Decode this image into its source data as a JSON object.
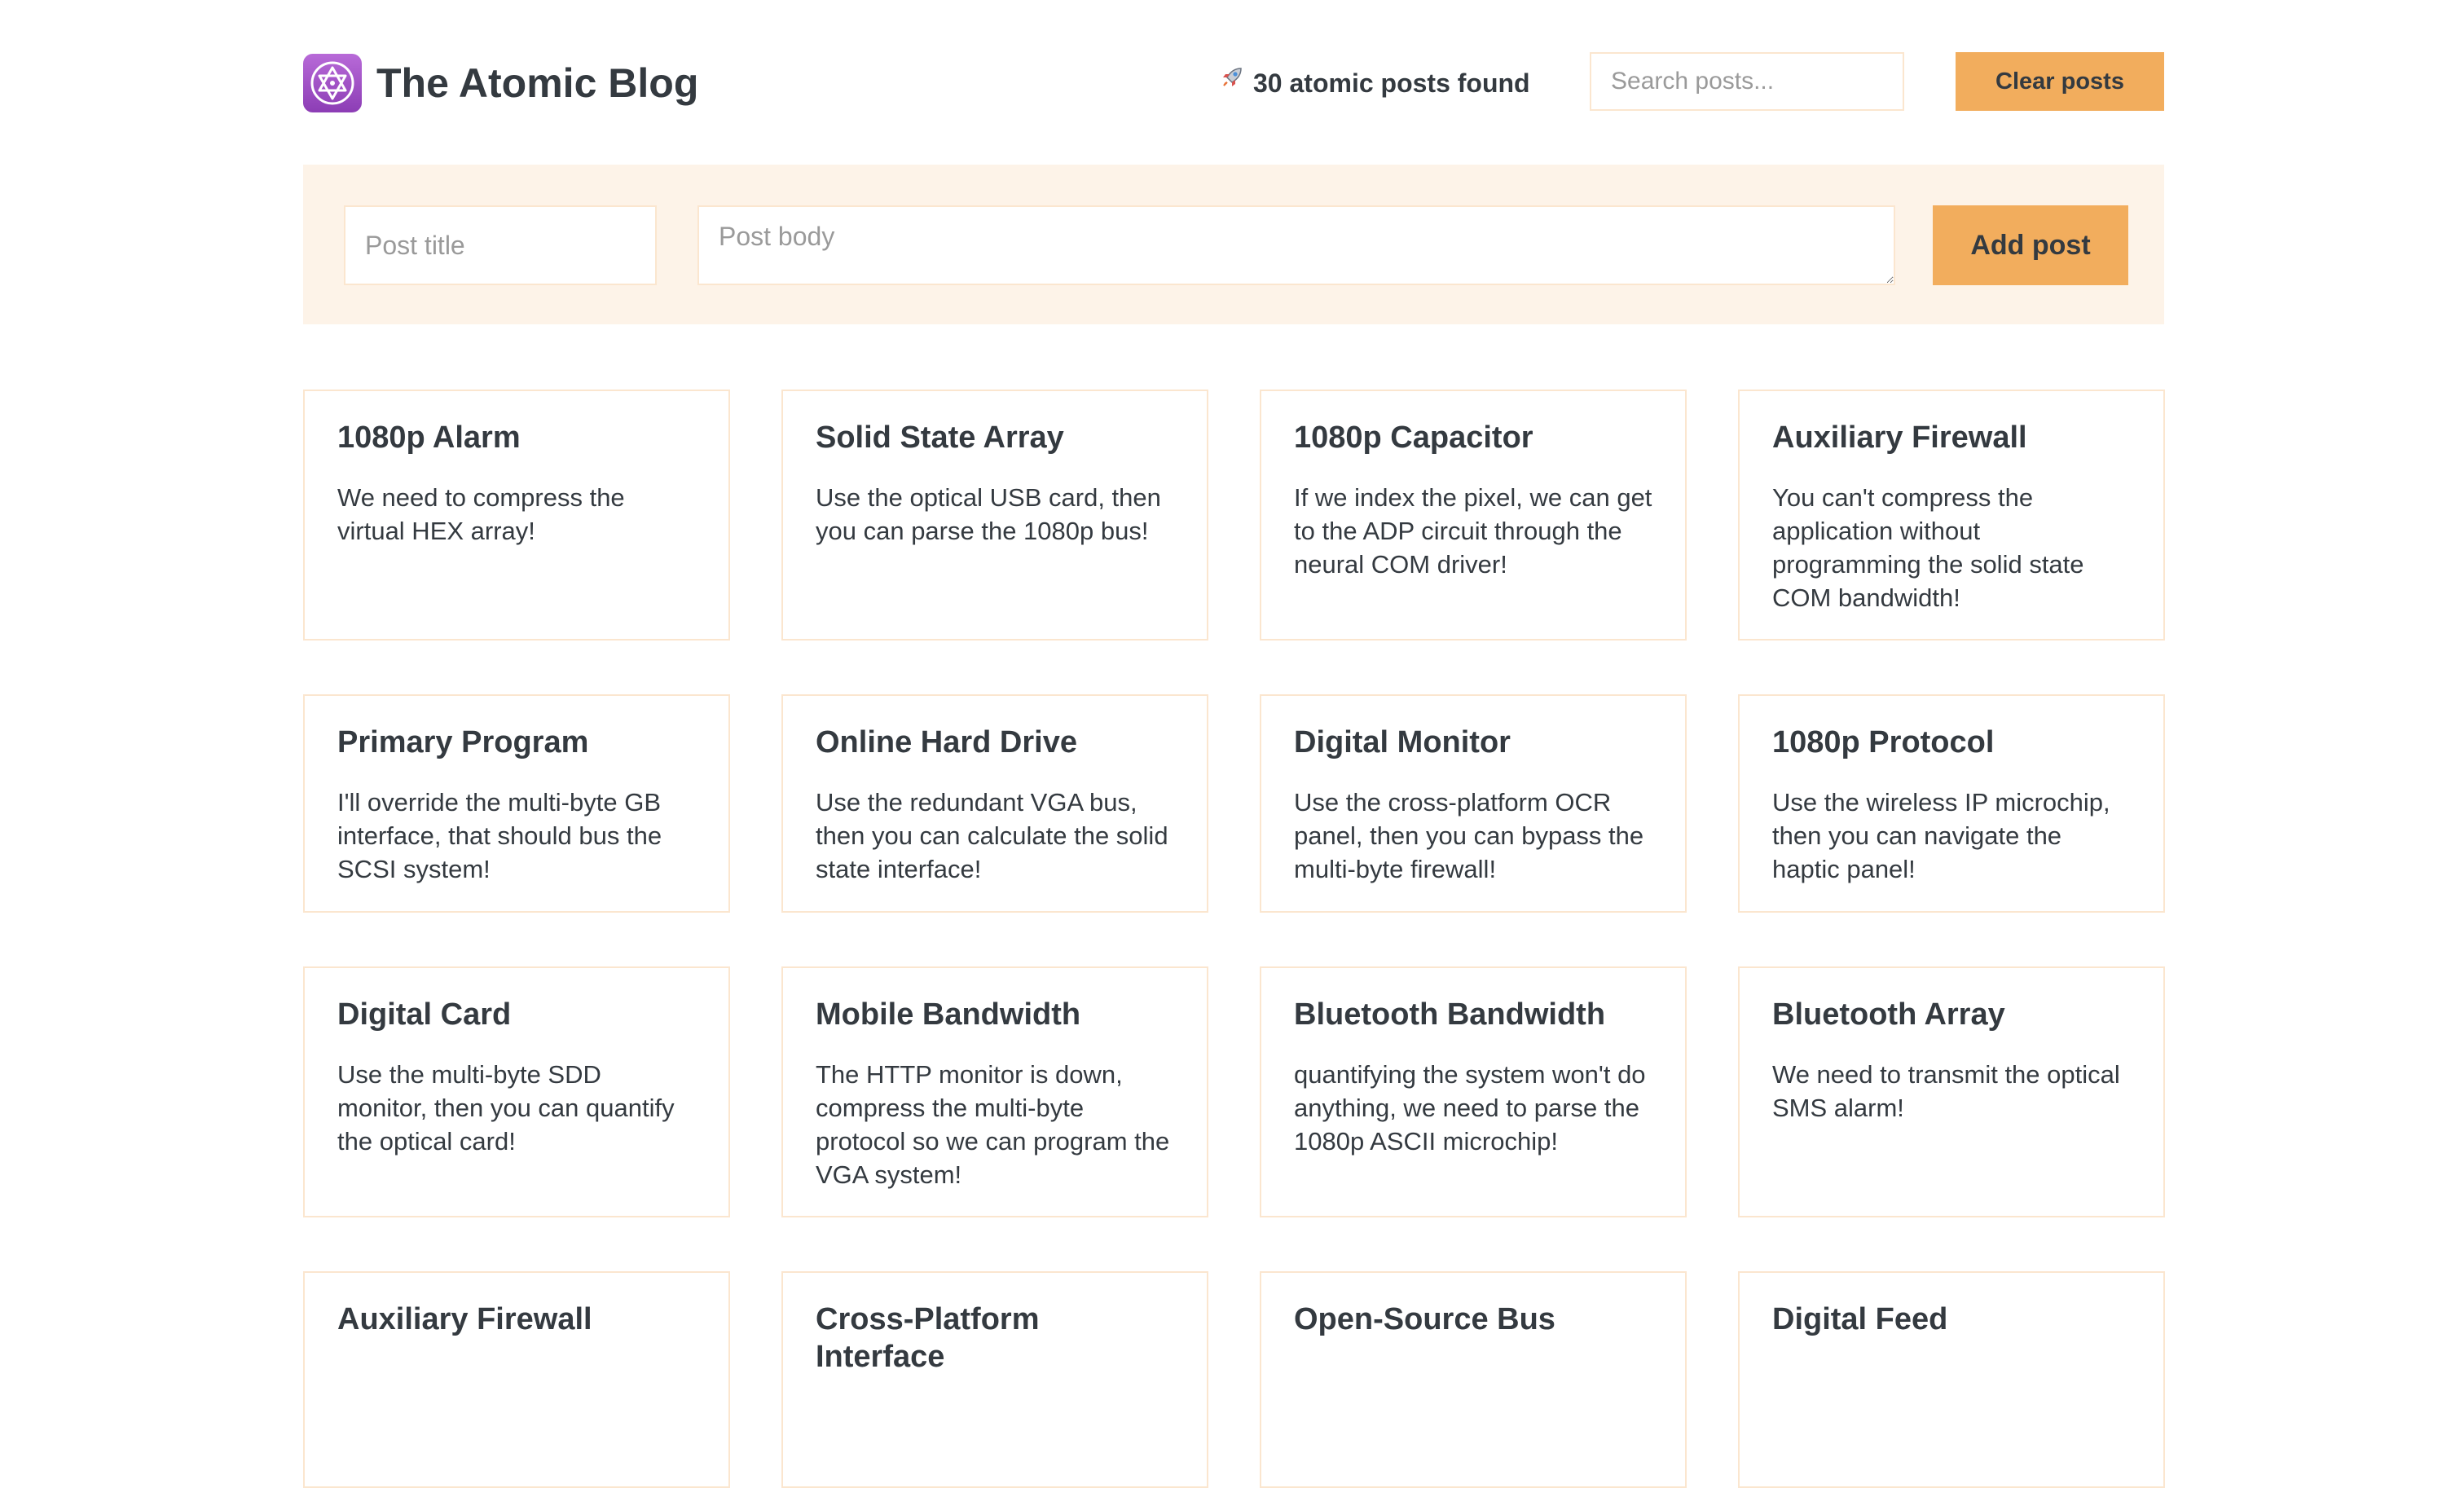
{
  "header": {
    "title": "The Atomic Blog",
    "logo_icon": "atom-icon",
    "results_icon": "rocket-icon",
    "results_text": "30 atomic posts found",
    "search_placeholder": "Search posts...",
    "clear_label": "Clear posts"
  },
  "form": {
    "title_placeholder": "Post title",
    "body_placeholder": "Post body",
    "add_label": "Add post"
  },
  "colors": {
    "accent": "#f2ad5d",
    "panel": "#fdf3e8",
    "border": "#fbe6cf",
    "text": "#343a40",
    "logo": "#9b4fc7"
  },
  "posts": [
    {
      "title": "1080p Alarm",
      "body": "We need to compress the virtual HEX array!"
    },
    {
      "title": "Solid State Array",
      "body": "Use the optical USB card, then you can parse the 1080p bus!"
    },
    {
      "title": "1080p Capacitor",
      "body": "If we index the pixel, we can get to the ADP circuit through the neural COM driver!"
    },
    {
      "title": "Auxiliary Firewall",
      "body": "You can't compress the application without programming the solid state COM bandwidth!"
    },
    {
      "title": "Primary Program",
      "body": "I'll override the multi-byte GB interface, that should bus the SCSI system!"
    },
    {
      "title": "Online Hard Drive",
      "body": "Use the redundant VGA bus, then you can calculate the solid state interface!"
    },
    {
      "title": "Digital Monitor",
      "body": "Use the cross-platform OCR panel, then you can bypass the multi-byte firewall!"
    },
    {
      "title": "1080p Protocol",
      "body": "Use the wireless IP microchip, then you can navigate the haptic panel!"
    },
    {
      "title": "Digital Card",
      "body": "Use the multi-byte SDD monitor, then you can quantify the optical card!"
    },
    {
      "title": "Mobile Bandwidth",
      "body": "The HTTP monitor is down, compress the multi-byte protocol so we can program the VGA system!"
    },
    {
      "title": "Bluetooth Bandwidth",
      "body": "quantifying the system won't do anything, we need to parse the 1080p ASCII microchip!"
    },
    {
      "title": "Bluetooth Array",
      "body": "We need to transmit the optical SMS alarm!"
    },
    {
      "title": "Auxiliary Firewall",
      "body": ""
    },
    {
      "title": "Cross-Platform Interface",
      "body": ""
    },
    {
      "title": "Open-Source Bus",
      "body": ""
    },
    {
      "title": "Digital Feed",
      "body": ""
    }
  ]
}
